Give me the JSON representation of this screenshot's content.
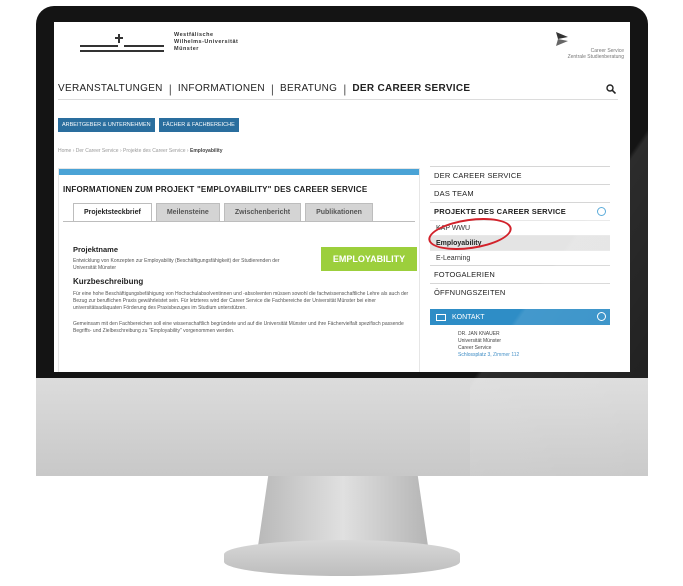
{
  "header": {
    "uni_line1": "Westfälische",
    "uni_line2": "Wilhelms-Universität",
    "uni_line3": "Münster",
    "cs_line1": "Career Service",
    "cs_line2": "Zentrale Studienberatung"
  },
  "main_nav": {
    "items": [
      "VERANSTALTUNGEN",
      "INFORMATIONEN",
      "BERATUNG",
      "DER CAREER SERVICE"
    ],
    "separator": "|",
    "search_icon": "search-icon"
  },
  "sub_nav": [
    "ARBEITGEBER & UNTERNEHMEN",
    "FÄCHER & FACHBEREICHE"
  ],
  "breadcrumb": {
    "path": "Home › Der Career Service › Projekte des Career Service › ",
    "current": "Employability"
  },
  "content": {
    "title": "INFORMATIONEN ZUM PROJEKT \"EMPLOYABILITY\" DES CAREER SERVICE",
    "tabs": [
      "Projektsteckbrief",
      "Meilensteine",
      "Zwischenbericht",
      "Publikationen"
    ],
    "button": "EMPLOYABILITY",
    "heading_projektname": "Projektname",
    "text_projektname": "Entwicklung von Konzepten zur Employability (Beschäftigungsfähigkeit) der Studierenden der Universität Münster",
    "heading_kurz": "Kurzbeschreibung",
    "text_kurz": "Für eine hohe Beschäftigungsbefähigung von Hochschulabsolventinnen und -absolventen müssen sowohl die fachwissenschaftliche Lehre als auch der Bezug zur beruflichen Praxis gewährleistet sein. Für letzteres wird der Career Service die Fachbereiche der Universität Münster bei einer universitätsadäquaten Förderung des Praxisbezuges im Studium unterstützen.",
    "text_more": "Gemeinsam mit den Fachbereichen soll eine wissenschaftlich begründete und auf die Universität Münster und ihre Fächervielfalt spezifisch passende Begriffs- und Zielbeschreibung zu \"Employability\" vorgenommen werden."
  },
  "sidebar": {
    "items": [
      "DER CAREER SERVICE",
      "DAS TEAM",
      "PROJEKTE DES CAREER SERVICE"
    ],
    "sub_items": [
      "KAP WWU",
      "Employability",
      "E-Learning"
    ],
    "items_after": [
      "FOTOGALERIEN",
      "ÖFFNUNGSZEITEN"
    ],
    "kontakt_label": "KONTAKT",
    "kontakt_lines": [
      "DR. JAN KNAUER",
      "Universität Münster",
      "Career Service"
    ],
    "kontakt_address": "Schlossplatz 3, Zimmer 112"
  },
  "colors": {
    "accent_blue": "#2e8dc6",
    "button_green": "#9ccf3c",
    "highlight_red": "#d2222b"
  }
}
